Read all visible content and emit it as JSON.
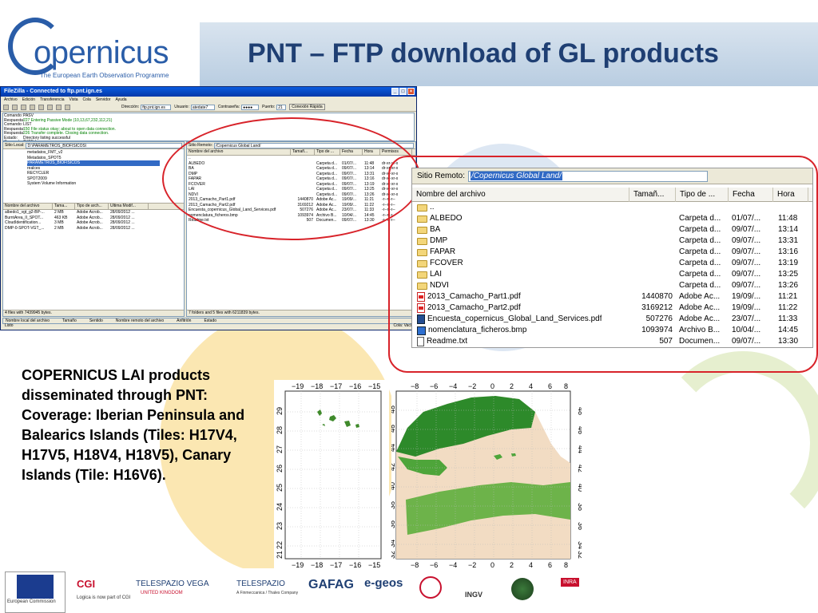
{
  "header": {
    "logo_text": "opernicus",
    "logo_sub": "The European Earth Observation Programme",
    "title": "PNT – FTP download of GL products"
  },
  "filezilla": {
    "window_title": "FileZilla - Connected to ftp.pnt.ign.es",
    "menu": [
      "Archivo",
      "Edición",
      "Transferencia",
      "Vista",
      "Cola",
      "Servidor",
      "Ayuda"
    ],
    "toolbar": {
      "direccion_label": "Dirección:",
      "direccion_value": "ftp.pnt.ign.es",
      "usuario_label": "Usuario:",
      "usuario_value": "atedate7",
      "contrasena_label": "Contraseña:",
      "contrasena_value": "●●●●",
      "puerto_label": "Puerto:",
      "puerto_value": "21",
      "connect_label": "Conexión Rápida"
    },
    "log": [
      {
        "k": "Comando:",
        "v": "PASV"
      },
      {
        "k": "Respuesta:",
        "v": "227 Entering Passive Mode (10,13,67,232,112,21)"
      },
      {
        "k": "Comando:",
        "v": "LIST"
      },
      {
        "k": "Respuesta:",
        "v": "150 File status okay; about to open data connection."
      },
      {
        "k": "Respuesta:",
        "v": "226 Transfer complete. Closing data connection."
      },
      {
        "k": "Estado:",
        "v": "Directory listing successful"
      },
      {
        "k": "Comando:",
        "v": "TYPE I"
      }
    ],
    "local": {
      "site_label": "Sitio Local:",
      "site_value": "D:\\PARAMETROS_BIOFISICOS\\",
      "tree": [
        "metadatos_FMT_v2",
        "Metadatos_SPOT5",
        "PARAMETROS_BIOFISICOS",
        "realces",
        "RECYCLER",
        "SPOT2009",
        "System Volume Information"
      ],
      "columns": [
        "Nombre del archivo",
        "Tama...",
        "Tipo de arch...",
        "Última Modif..."
      ],
      "files": [
        [
          "albedo1_vgt_g2-BP-...",
          "2 MB",
          "Adobe Acrob...",
          "28/09/2012 ..."
        ],
        [
          "BurntArea_II_SPOT...",
          "463 KB",
          "Adobe Acrob...",
          "28/09/2012 ..."
        ],
        [
          "CloudIdentification...",
          "3 MB",
          "Adobe Acrob...",
          "28/09/2012 ..."
        ],
        [
          "DMP-0-SPOT-VGT_...",
          "2 MB",
          "Adobe Acrob...",
          "28/09/2012 ..."
        ]
      ],
      "status": "4 files with 7439945 bytes."
    },
    "remote": {
      "site_label": "Sitio Remoto:",
      "site_value": "/Copernicus Global Land/",
      "columns": [
        "Nombre del archivo",
        "Tamañ...",
        "Tipo de ...",
        "Fecha",
        "Hora",
        "Permisos"
      ],
      "files": [
        [
          "..",
          "",
          "",
          "",
          "",
          ""
        ],
        [
          "ALBEDO",
          "",
          "Carpeta d...",
          "01/07/...",
          "11:48",
          "dr-xr-xr-x"
        ],
        [
          "BA",
          "",
          "Carpeta d...",
          "09/07/...",
          "13:14",
          "dr-xr-xr-x"
        ],
        [
          "DMP",
          "",
          "Carpeta d...",
          "09/07/...",
          "13:31",
          "dr-xr-xr-x"
        ],
        [
          "FAPAR",
          "",
          "Carpeta d...",
          "09/07/...",
          "13:16",
          "dr-xr-xr-x"
        ],
        [
          "FCOVER",
          "",
          "Carpeta d...",
          "09/07/...",
          "13:19",
          "dr-xr-xr-x"
        ],
        [
          "LAI",
          "",
          "Carpeta d...",
          "09/07/...",
          "13:25",
          "dr-xr-xr-x"
        ],
        [
          "NDVI",
          "",
          "Carpeta d...",
          "09/07/...",
          "13:26",
          "dr-xr-xr-x"
        ],
        [
          "2013_Camacho_Part1.pdf",
          "1440870",
          "Adobe Ac...",
          "19/09/...",
          "11:21",
          "-r--r--r--"
        ],
        [
          "2013_Camacho_Part2.pdf",
          "3169212",
          "Adobe Ac...",
          "19/09/...",
          "11:22",
          "-r--r--r--"
        ],
        [
          "Encuesta_copernicus_Global_Land_Services.pdf",
          "507276",
          "Adobe Ac...",
          "23/07/...",
          "11:33",
          "-r--r--r--"
        ],
        [
          "nomenclatura_ficheros.bmp",
          "1093974",
          "Archivo B...",
          "10/04/...",
          "14:45",
          "-r--r--r--"
        ],
        [
          "Readme.txt",
          "507",
          "Documen...",
          "09/07/...",
          "13:30",
          "-r--r--r--"
        ]
      ],
      "status": "7 folders and 5 files with 6211839 bytes."
    },
    "queue_columns": [
      "Nombre local del archivo",
      "Tamaño",
      "Sentido",
      "Nombre remoto del archivo",
      "Anfitrión",
      "Estado"
    ],
    "footer_left": "Listo",
    "footer_right": "Cola: Vacío"
  },
  "zoom": {
    "site_label": "Sitio Remoto:",
    "site_value": "/Copernicus Global Land/",
    "columns": [
      "Nombre del archivo",
      "Tamañ...",
      "Tipo de ...",
      "Fecha",
      "Hora"
    ],
    "files": [
      {
        "icon": "folder-up",
        "name": "..",
        "size": "",
        "type": "",
        "date": "",
        "time": ""
      },
      {
        "icon": "folder",
        "name": "ALBEDO",
        "size": "",
        "type": "Carpeta d...",
        "date": "01/07/...",
        "time": "11:48"
      },
      {
        "icon": "folder",
        "name": "BA",
        "size": "",
        "type": "Carpeta d...",
        "date": "09/07/...",
        "time": "13:14"
      },
      {
        "icon": "folder",
        "name": "DMP",
        "size": "",
        "type": "Carpeta d...",
        "date": "09/07/...",
        "time": "13:31"
      },
      {
        "icon": "folder",
        "name": "FAPAR",
        "size": "",
        "type": "Carpeta d...",
        "date": "09/07/...",
        "time": "13:16"
      },
      {
        "icon": "folder",
        "name": "FCOVER",
        "size": "",
        "type": "Carpeta d...",
        "date": "09/07/...",
        "time": "13:19"
      },
      {
        "icon": "folder",
        "name": "LAI",
        "size": "",
        "type": "Carpeta d...",
        "date": "09/07/...",
        "time": "13:25"
      },
      {
        "icon": "folder",
        "name": "NDVI",
        "size": "",
        "type": "Carpeta d...",
        "date": "09/07/...",
        "time": "13:26"
      },
      {
        "icon": "pdf",
        "name": "2013_Camacho_Part1.pdf",
        "size": "1440870",
        "type": "Adobe Ac...",
        "date": "19/09/...",
        "time": "11:21"
      },
      {
        "icon": "pdf",
        "name": "2013_Camacho_Part2.pdf",
        "size": "3169212",
        "type": "Adobe Ac...",
        "date": "19/09/...",
        "time": "11:22"
      },
      {
        "icon": "pdf-blue",
        "name": "Encuesta_copernicus_Global_Land_Services.pdf",
        "size": "507276",
        "type": "Adobe Ac...",
        "date": "23/07/...",
        "time": "11:33"
      },
      {
        "icon": "bmp",
        "name": "nomenclatura_ficheros.bmp",
        "size": "1093974",
        "type": "Archivo B...",
        "date": "10/04/...",
        "time": "14:45"
      },
      {
        "icon": "txt",
        "name": "Readme.txt",
        "size": "507",
        "type": "Documen...",
        "date": "09/07/...",
        "time": "13:30"
      }
    ]
  },
  "description": "COPERNICUS LAI products disseminated through PNT: Coverage: Iberian Peninsula and Balearics Islands (Tiles: H17V4, H17V5, H18V4, H18V5), Canary Islands (Tile: H16V6).",
  "map1": {
    "top_ticks": [
      "−19",
      "−18",
      "−17",
      "−16",
      "−15"
    ],
    "bottom_ticks": [
      "−19",
      "−18",
      "−17",
      "−16",
      "−15"
    ],
    "left_ticks": [
      "29",
      "28",
      "27",
      "26",
      "25",
      "24",
      "23",
      "22",
      "21"
    ]
  },
  "map2": {
    "top_ticks": [
      "−8",
      "−6",
      "−4",
      "−2",
      "0",
      "2",
      "4",
      "6",
      "8"
    ],
    "bottom_ticks": [
      "−8",
      "−6",
      "−4",
      "−2",
      "0",
      "2",
      "4",
      "6",
      "8"
    ],
    "left_ticks": [
      "48",
      "46",
      "44",
      "42",
      "40",
      "38",
      "36",
      "34",
      "32"
    ],
    "right_ticks": [
      "48",
      "46",
      "44",
      "42",
      "40",
      "38",
      "36",
      "34",
      "32"
    ]
  },
  "footer_logos": {
    "eu": "European Commission",
    "cgi": "CGI",
    "cgi_sub": "Logica is now part of CGI",
    "telespazio_uk": "TELESPAZIO VEGA",
    "telespazio_uk_sub": "UNITED KINGDOM",
    "telespazio": "TELESPAZIO",
    "telespazio_sub": "A Finmeccanica / Thales Company",
    "gafag": "GAFAG",
    "egeos": "e-geos",
    "ingv": "INGV",
    "inra": "INRA"
  },
  "colors": {
    "title": "#1f3f73",
    "copernicus_blue": "#2a5da8",
    "highlight_red": "#d8232a",
    "selection_blue": "#316ac5"
  }
}
